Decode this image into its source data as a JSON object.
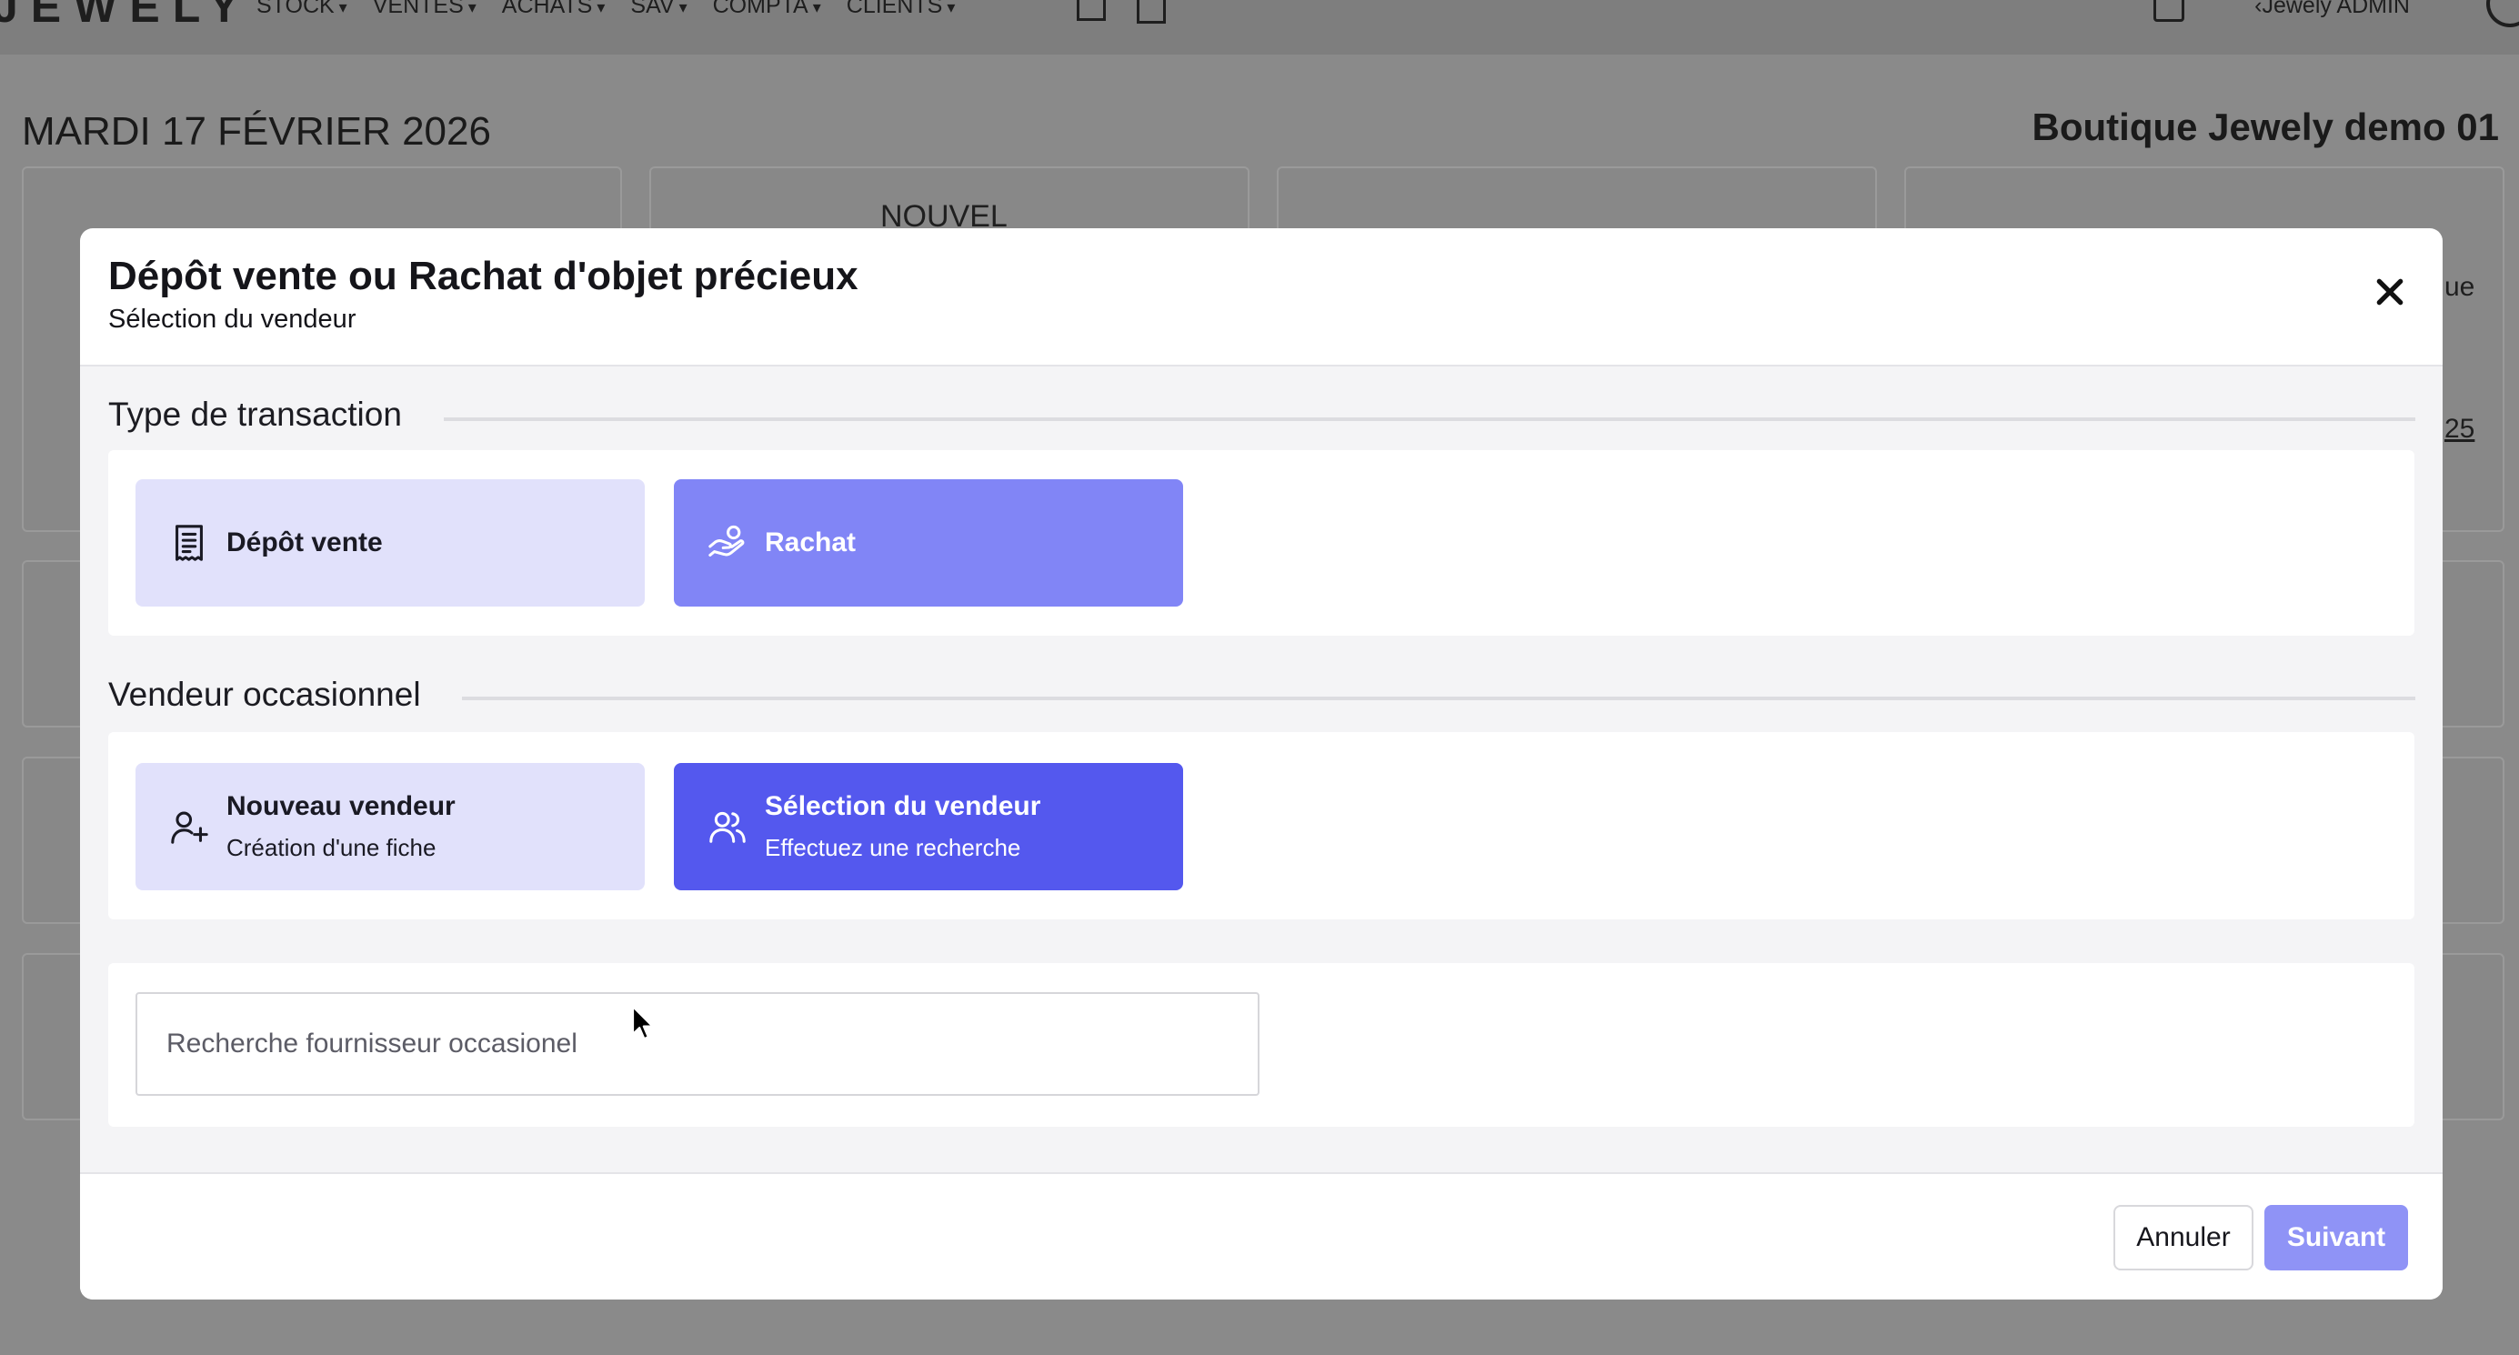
{
  "app": {
    "logo": "JEWELY",
    "nav": [
      "STOCK",
      "VENTES",
      "ACHATS",
      "SAV",
      "COMPTA",
      "CLIENTS"
    ],
    "user": "Jewely ADMIN",
    "date": "MARDI 17 FÉVRIER 2026",
    "shop": "Boutique Jewely demo 01",
    "cards": {
      "nouvel": "NOUVEL",
      "ue_fragment": "ue",
      "num_fragment": "25"
    }
  },
  "modal": {
    "title": "Dépôt vente ou Rachat d'objet précieux",
    "subtitle": "Sélection du vendeur",
    "close_icon": "close-icon",
    "transaction": {
      "heading": "Type de transaction",
      "options": [
        {
          "label": "Dépôt vente",
          "icon": "receipt-icon",
          "state": "unselected"
        },
        {
          "label": "Rachat",
          "icon": "hand-coins-icon",
          "state": "selected"
        }
      ]
    },
    "seller": {
      "heading": "Vendeur occasionnel",
      "options": [
        {
          "label": "Nouveau vendeur",
          "sub": "Création d'une fiche",
          "icon": "user-plus-icon",
          "state": "unselected"
        },
        {
          "label": "Sélection du vendeur",
          "sub": "Effectuez une recherche",
          "icon": "users-icon",
          "state": "selected"
        }
      ]
    },
    "search": {
      "placeholder": "Recherche fournisseur occasionel",
      "value": ""
    },
    "footer": {
      "cancel": "Annuler",
      "next": "Suivant"
    }
  },
  "colors": {
    "option_light": "#e1e1fb",
    "option_selected_transaction": "#8185f6",
    "option_selected_seller": "#5458ee",
    "next_button": "#8f93f6",
    "overlay": "#8a8a8a"
  }
}
